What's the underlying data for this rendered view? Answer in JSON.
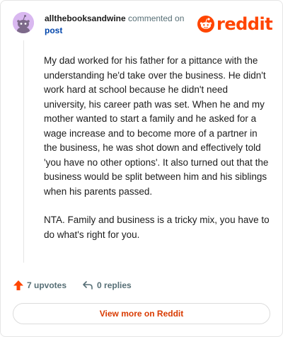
{
  "header": {
    "username": "allthebooksandwine",
    "action_text": "commented on",
    "post_link": "post",
    "logo_text": "reddit"
  },
  "comment": {
    "paragraphs": [
      "My dad worked for his father for a pittance with the understanding he'd take over the business. He didn't work hard at school because he didn't need university, his career path was set. When he and my mother wanted to start a family and he asked for a wage increase and to become more of a partner in the business, he was shot down and effectively told 'you have no other options'. It also turned out that the business would be split between him and his siblings when his parents passed.",
      "NTA. Family and business is a tricky mix, you have to do what's right for you."
    ]
  },
  "actions": {
    "upvotes": "7 upvotes",
    "replies": "0 replies"
  },
  "footer": {
    "view_more": "View more on Reddit"
  },
  "colors": {
    "brand": "#ff4500",
    "link": "#0045ac",
    "view_more": "#d93a00",
    "avatar_bg": "#d9b8f0"
  },
  "icons": {
    "avatar": "snoo-avatar-icon",
    "logo": "reddit-snoo-icon",
    "upvote": "upvote-arrow-icon",
    "reply": "reply-arrow-icon"
  }
}
